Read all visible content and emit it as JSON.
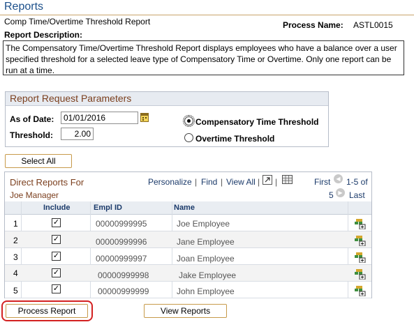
{
  "page": {
    "title": "Reports",
    "subtitle": "Comp Time/Overtime Threshold Report",
    "process_name_label": "Process Name:",
    "process_name_value": "ASTL0015",
    "description_label": "Report Description:",
    "description_text": "The Compensatory Time/Overtime Threshold Report displays employees who have a balance over a user specified threshold for a selected leave type of Compensatory Time or Overtime. Only one report can be run at a time."
  },
  "params": {
    "heading": "Report Request Parameters",
    "as_of_label": "As of Date:",
    "as_of_value": "01/01/2016",
    "threshold_label": "Threshold:",
    "threshold_value": "2.00",
    "radio_comp_label": "Compensatory Time Threshold",
    "radio_overtime_label": "Overtime Threshold",
    "selected": "comp"
  },
  "buttons": {
    "select_all": "Select All",
    "process_report": "Process Report",
    "view_reports": "View Reports"
  },
  "grid": {
    "title": "Direct Reports For",
    "subtitle": "Joe Manager",
    "personalize": "Personalize",
    "find": "Find",
    "view_all": "View All",
    "first": "First",
    "range": "1-5 of",
    "total": "5",
    "last": "Last",
    "columns": {
      "include": "Include",
      "emplid": "Empl ID",
      "name": "Name"
    },
    "rows": [
      {
        "num": "1",
        "checked": true,
        "emplid": "00000999995",
        "name": "Joe Employee"
      },
      {
        "num": "2",
        "checked": true,
        "emplid": "00000999996",
        "name": "Jane Employee"
      },
      {
        "num": "3",
        "checked": true,
        "emplid": "00000999997",
        "name": "Joan Employee"
      },
      {
        "num": "4",
        "checked": true,
        "emplid": "00000999998",
        "name": "Jake Employee"
      },
      {
        "num": "5",
        "checked": true,
        "emplid": "00000999999",
        "name": "John Employee"
      }
    ]
  },
  "icons": {
    "calendar": "calendar-icon",
    "zoom": "zoom-grid-icon",
    "download": "download-excel-icon",
    "prev": "previous-row-icon",
    "next": "next-row-icon",
    "row_detail": "row-detail-icon"
  },
  "colors": {
    "title_blue": "#1b4f8a",
    "section_brown": "#7b3f1e",
    "button_border": "#c79a4a",
    "highlight_red": "#d32121"
  }
}
